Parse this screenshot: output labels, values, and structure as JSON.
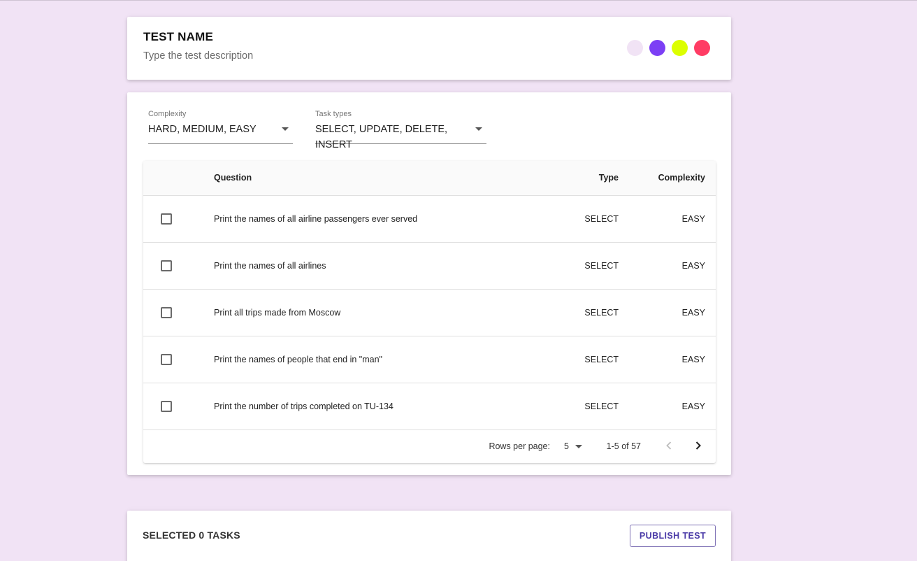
{
  "header": {
    "title": "TEST NAME",
    "description": "Type the test description",
    "swatches": [
      {
        "name": "lavender",
        "color": "#f1e3f5"
      },
      {
        "name": "purple",
        "color": "#7c3ff5"
      },
      {
        "name": "lime",
        "color": "#dcff00"
      },
      {
        "name": "red",
        "color": "#ff3c64"
      }
    ]
  },
  "filters": {
    "complexity": {
      "label": "Complexity",
      "value": "HARD, MEDIUM, EASY"
    },
    "task_types": {
      "label": "Task types",
      "value": "SELECT, UPDATE, DELETE, INSERT"
    }
  },
  "table": {
    "columns": {
      "question": "Question",
      "type": "Type",
      "complexity": "Complexity"
    },
    "rows": [
      {
        "question": "Print the names of all airline passengers ever served",
        "type": "SELECT",
        "complexity": "EASY"
      },
      {
        "question": "Print the names of all airlines",
        "type": "SELECT",
        "complexity": "EASY"
      },
      {
        "question": "Print all trips made from Moscow",
        "type": "SELECT",
        "complexity": "EASY"
      },
      {
        "question": "Print the names of people that end in \"man\"",
        "type": "SELECT",
        "complexity": "EASY"
      },
      {
        "question": "Print the number of trips completed on TU-134",
        "type": "SELECT",
        "complexity": "EASY"
      }
    ],
    "pagination": {
      "rows_per_page_label": "Rows per page:",
      "rows_per_page": "5",
      "range": "1-5 of 57"
    }
  },
  "footer": {
    "selected_label": "SELECTED 0 TASKS",
    "publish_label": "PUBLISH TEST"
  }
}
